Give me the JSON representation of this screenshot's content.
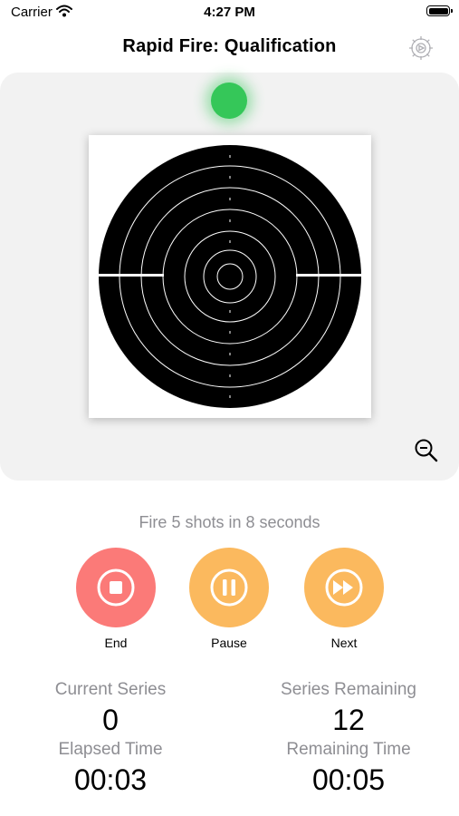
{
  "status_bar": {
    "carrier": "Carrier",
    "time": "4:27 PM"
  },
  "header": {
    "title": "Rapid Fire: Qualification",
    "settings_icon": "gear-icon"
  },
  "target": {
    "indicator_color": "#35c759",
    "zoom_icon": "zoom-out-icon"
  },
  "instruction": "Fire 5 shots in 8 seconds",
  "controls": {
    "end": {
      "label": "End",
      "color": "#fb7a78",
      "icon": "stop-icon"
    },
    "pause": {
      "label": "Pause",
      "color": "#fbb95e",
      "icon": "pause-icon"
    },
    "next": {
      "label": "Next",
      "color": "#fbb95e",
      "icon": "fast-forward-icon"
    }
  },
  "stats": {
    "current_series": {
      "label": "Current Series",
      "value": "0"
    },
    "series_remaining": {
      "label": "Series Remaining",
      "value": "12"
    },
    "elapsed_time": {
      "label": "Elapsed Time",
      "value": "00:03"
    },
    "remaining_time": {
      "label": "Remaining Time",
      "value": "00:05"
    }
  }
}
